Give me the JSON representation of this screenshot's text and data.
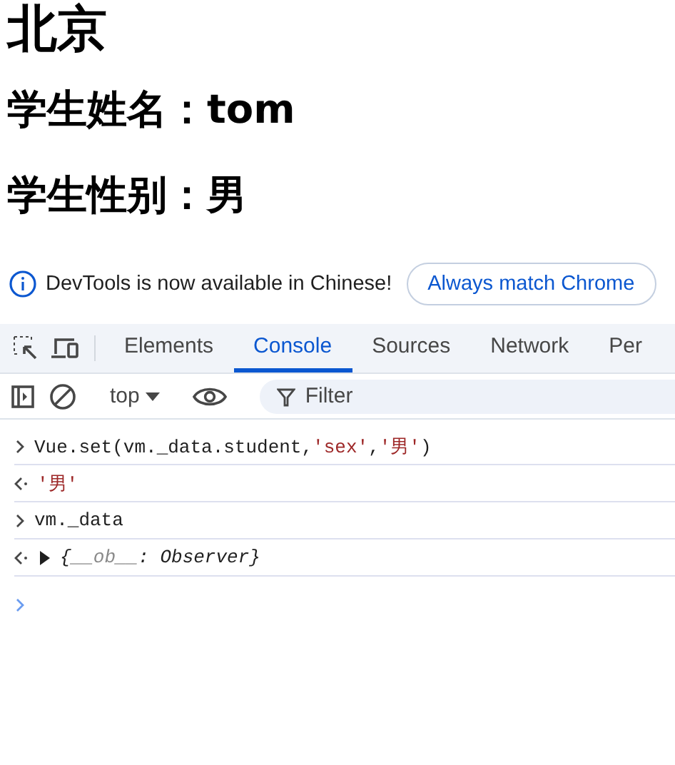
{
  "page": {
    "headings": [
      {
        "kind": "h1",
        "text": "北京"
      },
      {
        "kind": "h2",
        "text": "学生姓名：tom"
      },
      {
        "kind": "h2",
        "text": "学生性别：男"
      }
    ]
  },
  "banner": {
    "message": "DevTools is now available in Chinese!",
    "button": "Always match Chrome"
  },
  "devtools": {
    "tabs": [
      {
        "label": "Elements",
        "selected": false
      },
      {
        "label": "Console",
        "selected": true
      },
      {
        "label": "Sources",
        "selected": false
      },
      {
        "label": "Network",
        "selected": false
      },
      {
        "label": "Per",
        "selected": false
      }
    ],
    "context": "top",
    "filter": {
      "placeholder": "Filter"
    }
  },
  "console": {
    "lines": [
      {
        "kind": "input",
        "tokens": [
          {
            "kind": "code",
            "text": "Vue.set(vm._data.student,"
          },
          {
            "kind": "string",
            "text": "'sex'"
          },
          {
            "kind": "code",
            "text": ","
          },
          {
            "kind": "string",
            "text": "'男'"
          },
          {
            "kind": "code",
            "text": ")"
          }
        ]
      },
      {
        "kind": "output",
        "tokens": [
          {
            "kind": "string",
            "text": "'男'"
          }
        ]
      },
      {
        "kind": "input",
        "tokens": [
          {
            "kind": "code",
            "text": "vm._data"
          }
        ]
      },
      {
        "kind": "object",
        "expanded": false,
        "tokens": [
          {
            "kind": "code",
            "text": "{"
          },
          {
            "kind": "key",
            "text": "__ob__"
          },
          {
            "kind": "code",
            "text": ": Observer}"
          }
        ]
      }
    ]
  }
}
